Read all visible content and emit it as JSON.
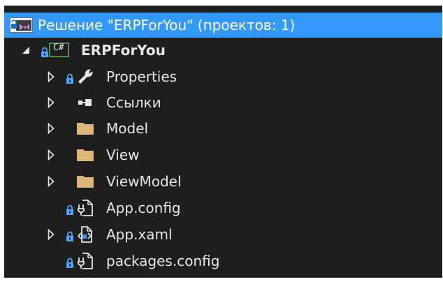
{
  "solution": {
    "label": "Решение \"ERPForYou\"  (проектов: 1)"
  },
  "project": {
    "label": "ERPForYou",
    "lang_badge": "C#"
  },
  "items": [
    {
      "label": "Properties",
      "icon": "wrench-icon"
    },
    {
      "label": "Ссылки",
      "icon": "references-icon"
    },
    {
      "label": "Model",
      "icon": "folder-icon"
    },
    {
      "label": "View",
      "icon": "folder-icon"
    },
    {
      "label": "ViewModel",
      "icon": "folder-icon"
    },
    {
      "label": "App.config",
      "icon": "config-file-icon"
    },
    {
      "label": "App.xaml",
      "icon": "xaml-file-icon"
    },
    {
      "label": "packages.config",
      "icon": "config-file-icon"
    }
  ],
  "colors": {
    "background": "#1e1e1e",
    "selection": "#3399ff",
    "text": "#e6e6e6",
    "folder": "#dcb67a",
    "lock": "#4aa3ff"
  }
}
